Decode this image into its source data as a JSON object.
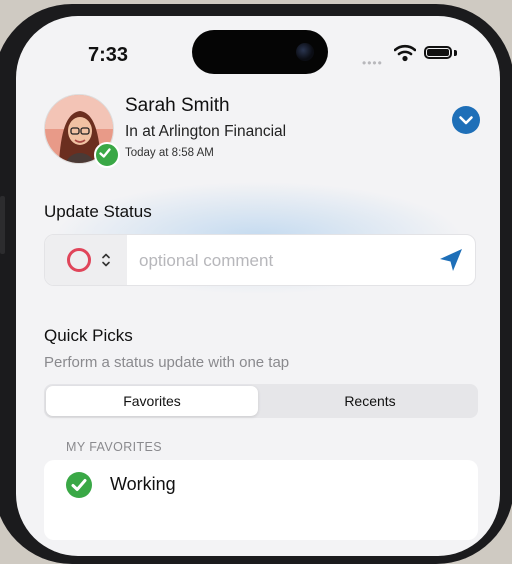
{
  "status_bar": {
    "time": "7:33"
  },
  "user": {
    "name": "Sarah Smith",
    "status": "In at Arlington Financial",
    "timestamp": "Today at 8:58 AM"
  },
  "update_status": {
    "title": "Update Status",
    "comment_placeholder": "optional comment",
    "comment_value": ""
  },
  "quick_picks": {
    "title": "Quick Picks",
    "subtitle": "Perform a status update with one tap",
    "tabs": [
      {
        "label": "Favorites",
        "selected": true
      },
      {
        "label": "Recents",
        "selected": false
      }
    ],
    "list_header": "MY FAVORITES",
    "items": [
      {
        "label": "Working",
        "icon": "green-check-icon"
      }
    ]
  },
  "colors": {
    "accent_blue": "#1e6fb8",
    "status_green": "#3aa846",
    "status_red": "#e0455a"
  }
}
